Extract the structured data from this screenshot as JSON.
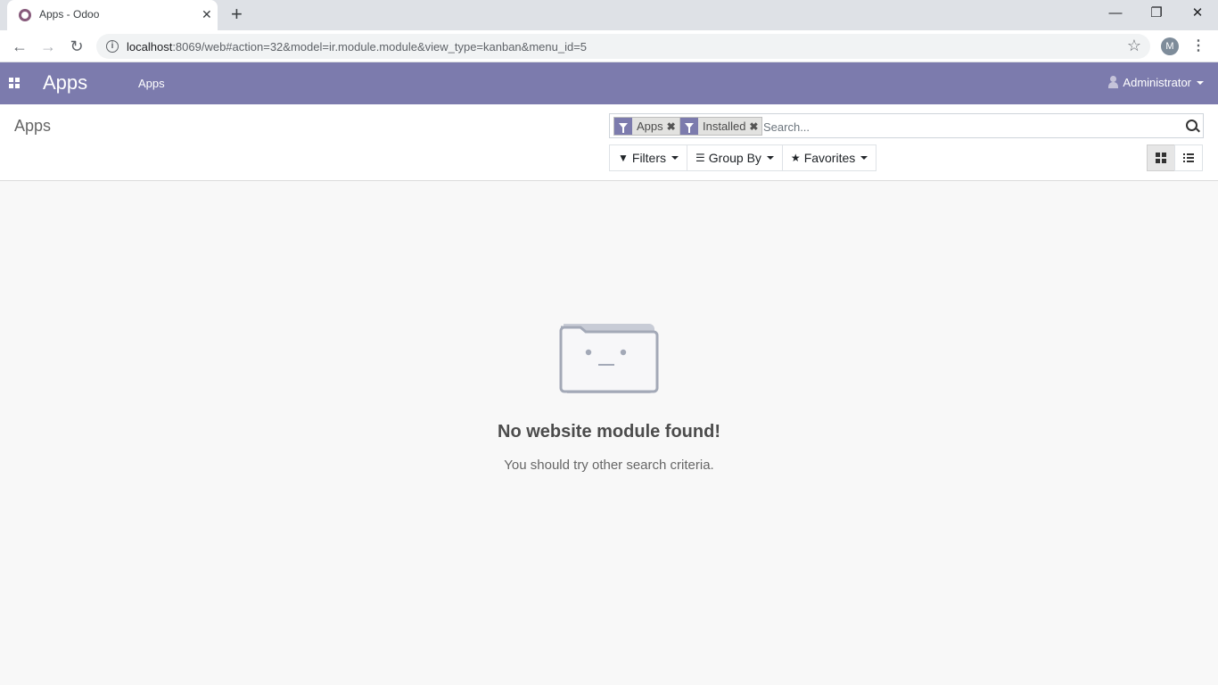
{
  "browser": {
    "tab_title": "Apps - Odoo",
    "url_host": "localhost",
    "url_rest": ":8069/web#action=32&model=ir.module.module&view_type=kanban&menu_id=5",
    "profile_initial": "M"
  },
  "navbar": {
    "brand": "Apps",
    "menu_item": "Apps",
    "user": "Administrator",
    "color": "#7c7bad"
  },
  "control_panel": {
    "breadcrumb": "Apps",
    "facets": [
      {
        "label": "Apps"
      },
      {
        "label": "Installed"
      }
    ],
    "search_placeholder": "Search...",
    "filters_label": "Filters",
    "groupby_label": "Group By",
    "favorites_label": "Favorites",
    "active_view": "kanban"
  },
  "empty_state": {
    "title": "No website module found!",
    "subtitle": "You should try other search criteria."
  }
}
